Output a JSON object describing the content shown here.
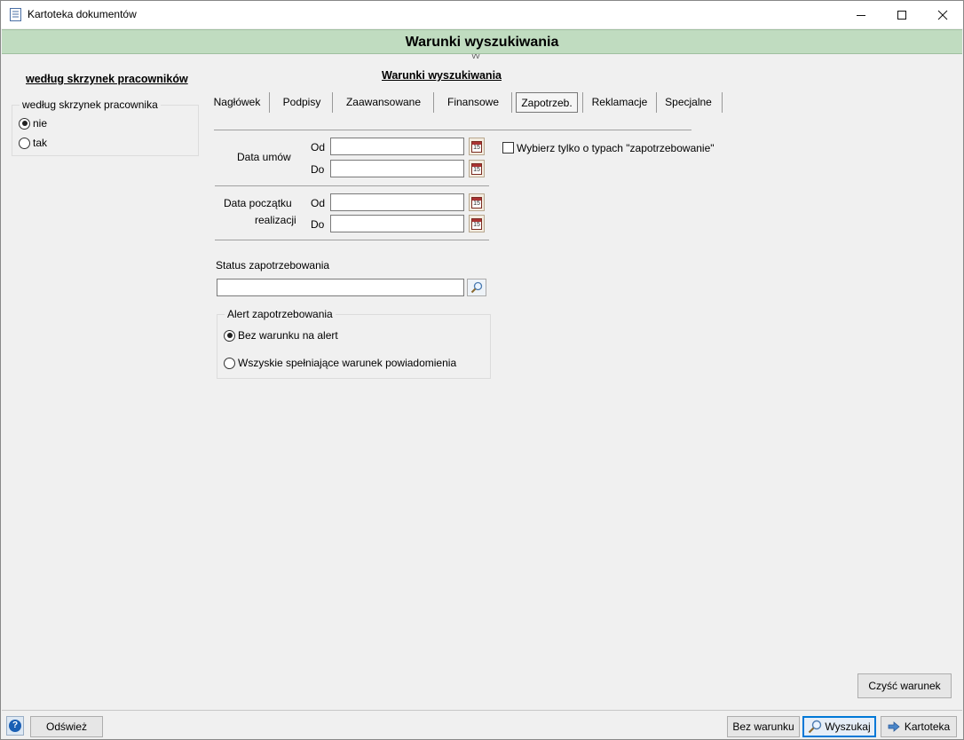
{
  "window": {
    "title": "Kartoteka dokumentów",
    "minimize_icon": "minimize-icon",
    "maximize_icon": "maximize-icon",
    "close_icon": "close-icon"
  },
  "header": {
    "title": "Warunki wyszukiwania",
    "accent_color": "#c0dcc0"
  },
  "left_panel": {
    "title": "według skrzynek pracowników",
    "group_label": "według skrzynek pracownika",
    "options": [
      {
        "label": "nie",
        "checked": true
      },
      {
        "label": "tak",
        "checked": false
      }
    ]
  },
  "main": {
    "title": "Warunki wyszukiwania",
    "tabs": [
      {
        "label": "Nagłówek",
        "active": false
      },
      {
        "label": "Podpisy",
        "active": false
      },
      {
        "label": "Zaawansowane",
        "active": false
      },
      {
        "label": "Finansowe",
        "active": false
      },
      {
        "label": "Zapotrzeb.",
        "active": true
      },
      {
        "label": "Reklamacje",
        "active": false
      },
      {
        "label": "Specjalne",
        "active": false
      }
    ],
    "data_umow": {
      "label": "Data umów",
      "from_label": "Od",
      "to_label": "Do",
      "from_value": "",
      "to_value": ""
    },
    "data_poczatku": {
      "label_line1": "Data początku",
      "label_line2": "realizacji",
      "from_label": "Od",
      "to_label": "Do",
      "from_value": "",
      "to_value": ""
    },
    "calendar_glyph": "15",
    "only_types_checkbox": {
      "label": "Wybierz tylko o typach \"zapotrzebowanie\"",
      "checked": false
    },
    "status": {
      "label": "Status zapotrzebowania",
      "value": ""
    },
    "alert": {
      "group_label": "Alert zapotrzebowania",
      "options": [
        {
          "label": "Bez warunku na alert",
          "checked": true
        },
        {
          "label": "Wszyskie spełniające warunek powiadomienia",
          "checked": false
        }
      ]
    },
    "clear_button": "Czyść warunek"
  },
  "footer": {
    "help_icon": "help-icon",
    "help_glyph": "?",
    "refresh": "Odśwież",
    "no_condition": "Bez warunku",
    "search": "Wyszukaj",
    "kartoteka": "Kartoteka"
  }
}
